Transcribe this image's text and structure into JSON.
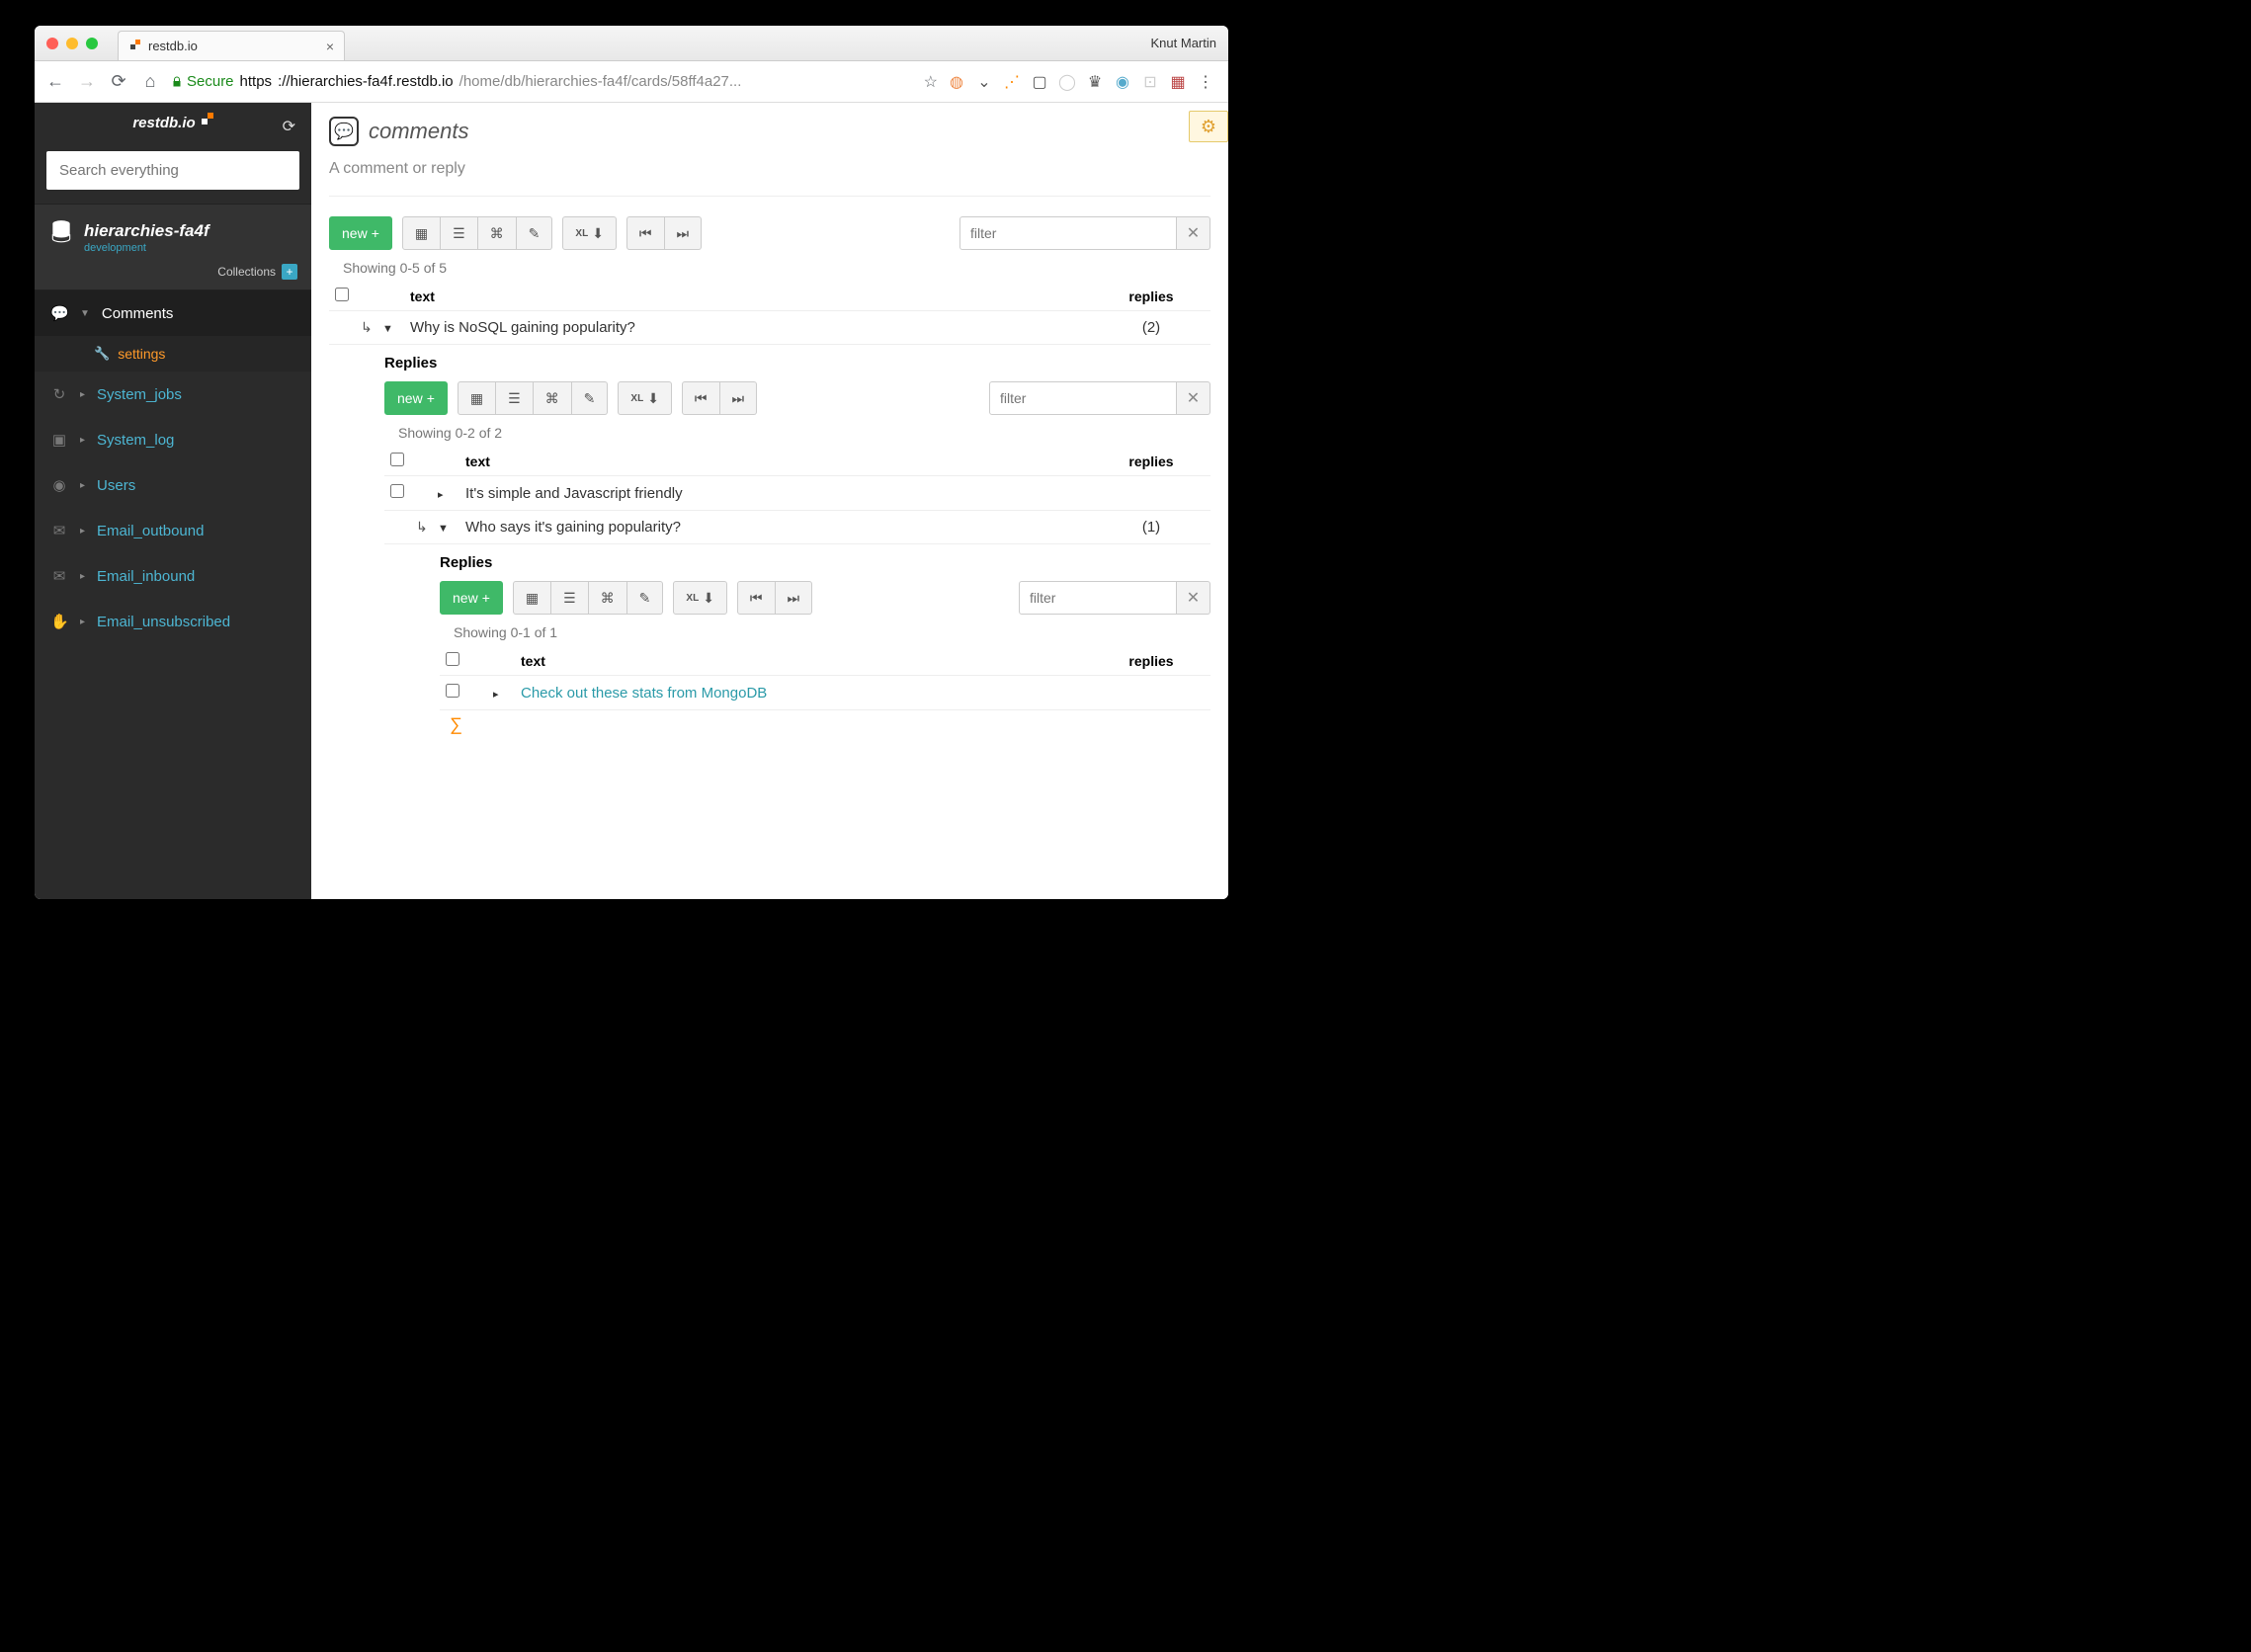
{
  "browser": {
    "tab_title": "restdb.io",
    "user_label": "Knut Martin",
    "url_secure": "Secure",
    "url_scheme": "https",
    "url_host": "://hierarchies-fa4f.restdb.io",
    "url_path": "/home/db/hierarchies-fa4f/cards/58ff4a27..."
  },
  "sidebar": {
    "brand": "restdb.io",
    "search_placeholder": "Search everything",
    "db_name": "hierarchies-fa4f",
    "db_sub": "development",
    "db_meta": "Collections",
    "items": [
      {
        "icon": "comments",
        "label": "Comments",
        "active": true
      },
      {
        "icon": "refresh",
        "label": "System_jobs"
      },
      {
        "icon": "terminal",
        "label": "System_log"
      },
      {
        "icon": "user",
        "label": "Users"
      },
      {
        "icon": "mail",
        "label": "Email_outbound"
      },
      {
        "icon": "mail",
        "label": "Email_inbound"
      },
      {
        "icon": "hand",
        "label": "Email_unsubscribed"
      }
    ],
    "settings_label": "settings"
  },
  "page": {
    "title": "comments",
    "subtitle": "A comment or reply"
  },
  "toolbar": {
    "new_label": "new",
    "xl_label": "XL",
    "filter_placeholder": "filter"
  },
  "level0": {
    "showing": "Showing 0-5 of 5",
    "headers": {
      "text": "text",
      "replies": "replies"
    },
    "rows": [
      {
        "text": "Why is NoSQL gaining popularity?",
        "replies": "(2)",
        "expanded": true
      }
    ]
  },
  "level1": {
    "title": "Replies",
    "showing": "Showing 0-2 of 2",
    "headers": {
      "text": "text",
      "replies": "replies"
    },
    "rows": [
      {
        "text": "It's simple and Javascript friendly",
        "replies": "",
        "expanded": false
      },
      {
        "text": "Who says it's gaining popularity?",
        "replies": "(1)",
        "expanded": true
      }
    ]
  },
  "level2": {
    "title": "Replies",
    "showing": "Showing 0-1 of 1",
    "headers": {
      "text": "text",
      "replies": "replies"
    },
    "rows": [
      {
        "text": "Check out these stats from MongoDB",
        "replies": "",
        "link": true
      }
    ]
  }
}
